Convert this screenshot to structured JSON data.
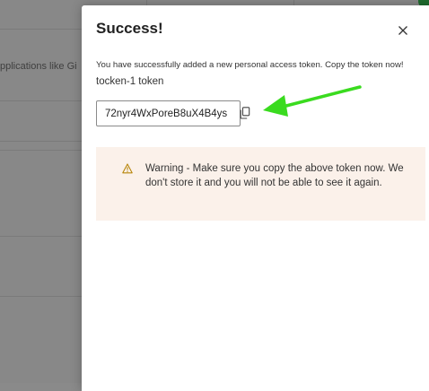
{
  "background": {
    "visible_text": "pplications like Gi"
  },
  "dialog": {
    "title": "Success!",
    "message": "You have successfully added a new personal access token. Copy the token now!",
    "token_name": "tocken-1 token",
    "token_value": "72nyr4WxPoreB8uX4B4ys",
    "warning": "Warning - Make sure you copy the above token now. We don't store it and you will not be able to see it again."
  },
  "icons": {
    "close": "close-icon",
    "copy": "copy-icon",
    "warning": "warning-icon",
    "annotation": "arrow-annotation-icon"
  },
  "colors": {
    "arrow": "#3adb1f",
    "warning_bg": "#fbf1ea",
    "warning_icon": "#b8860b",
    "overlay": "#888888"
  }
}
